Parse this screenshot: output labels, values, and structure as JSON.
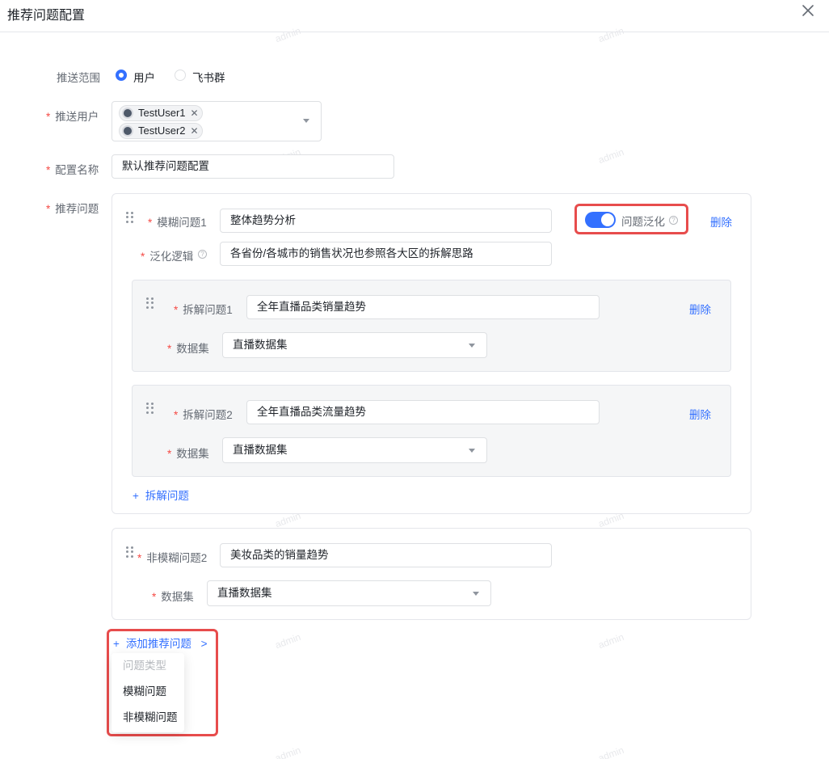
{
  "dialog": {
    "title": "推荐问题配置"
  },
  "watermark": "admin",
  "push_scope": {
    "label": "推送范围",
    "options": [
      "用户",
      "飞书群"
    ],
    "selected": "用户"
  },
  "push_users": {
    "label": "推送用户",
    "tags": [
      "TestUser1",
      "TestUser2"
    ]
  },
  "config_name": {
    "label": "配置名称",
    "value": "默认推荐问题配置"
  },
  "recommend": {
    "label": "推荐问题",
    "fuzzy": {
      "label": "模糊问题1",
      "value": "整体趋势分析",
      "generalize_label": "问题泛化",
      "generalize_enabled": true,
      "delete": "删除",
      "logic_label": "泛化逻辑",
      "logic_value": "各省份/各城市的销售状况也参照各大区的拆解思路",
      "subs": [
        {
          "label": "拆解问题1",
          "value": "全年直播品类销量趋势",
          "delete": "删除",
          "dataset_label": "数据集",
          "dataset": "直播数据集"
        },
        {
          "label": "拆解问题2",
          "value": "全年直播品类流量趋势",
          "delete": "删除",
          "dataset_label": "数据集",
          "dataset": "直播数据集"
        }
      ],
      "add_sub": "拆解问题"
    },
    "nonfuzzy": {
      "label": "非模糊问题2",
      "value": "美妆品类的销量趋势",
      "dataset_label": "数据集",
      "dataset": "直播数据集"
    },
    "add": {
      "label": "添加推荐问题",
      "arrow": ">"
    },
    "menu": {
      "header": "问题类型",
      "items": [
        "模糊问题",
        "非模糊问题"
      ]
    }
  },
  "colors": {
    "primary": "#3370ff",
    "required": "#f54a45",
    "highlight": "#e74c4c"
  }
}
